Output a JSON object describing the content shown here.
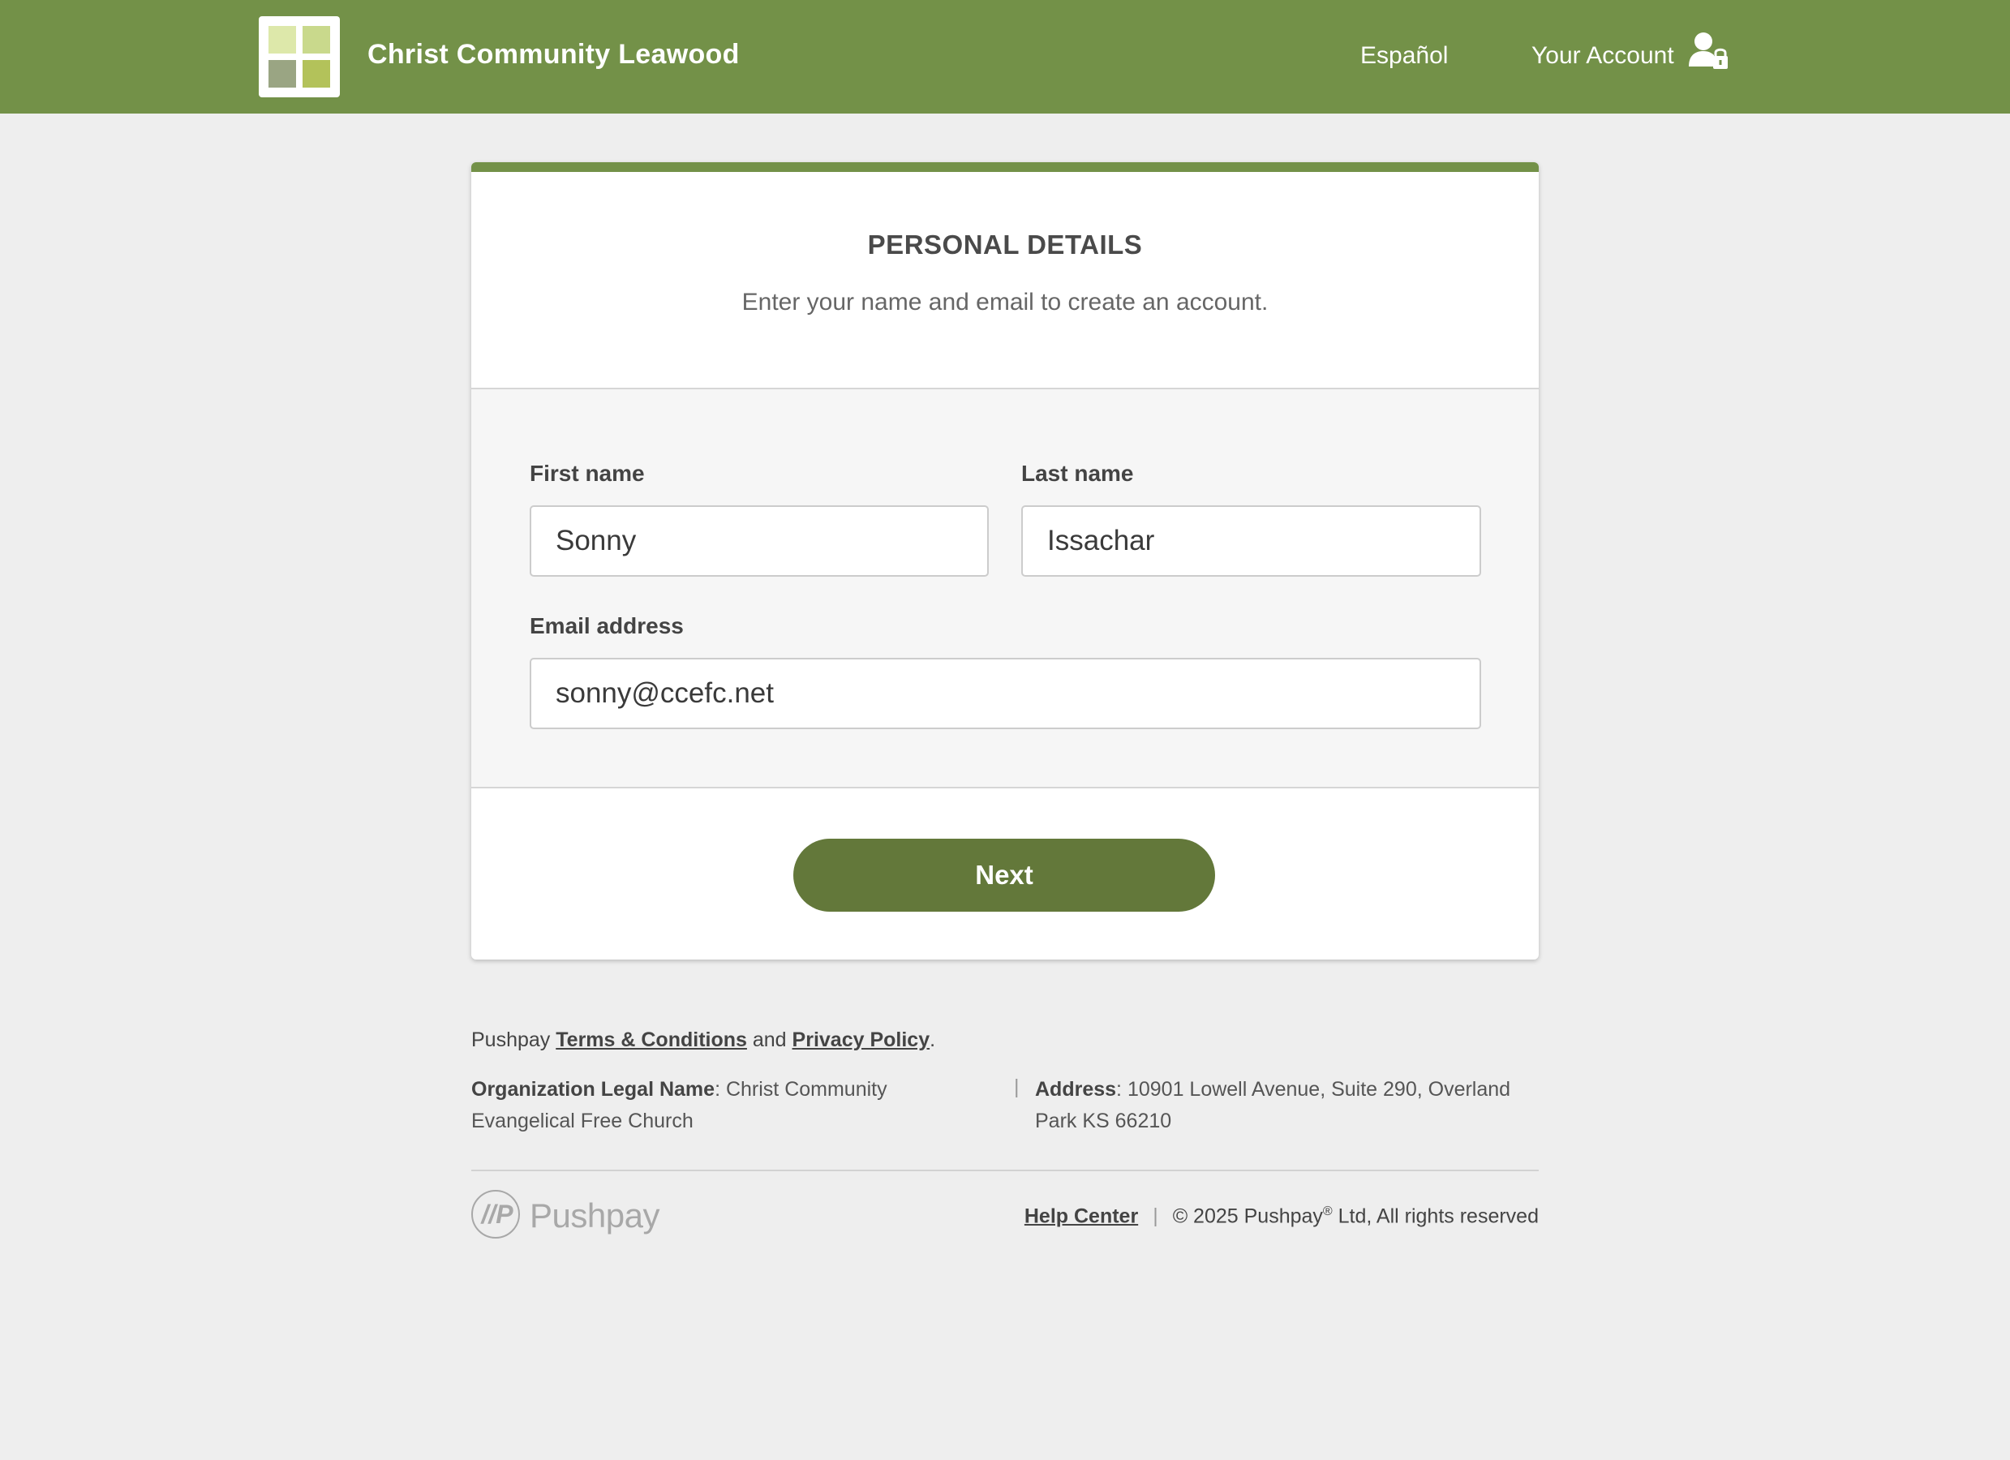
{
  "header": {
    "org_name": "Christ Community Leawood",
    "language_link": "Español",
    "account_link": "Your Account",
    "brand_color": "#739148"
  },
  "card": {
    "title": "PERSONAL DETAILS",
    "subtitle": "Enter your name and email to create an account.",
    "fields": {
      "first_name": {
        "label": "First name",
        "value": "Sonny"
      },
      "last_name": {
        "label": "Last name",
        "value": "Issachar"
      },
      "email": {
        "label": "Email address",
        "value": "sonny@ccefc.net"
      }
    },
    "next_label": "Next",
    "button_color": "#63783a"
  },
  "footer": {
    "legal_prefix": "Pushpay",
    "terms_link": "Terms & Conditions",
    "and_text": "and",
    "privacy_link": "Privacy Policy",
    "period": ".",
    "org_legal_label": "Organization Legal Name",
    "org_legal_value": "Christ Community Evangelical Free Church",
    "address_label": "Address",
    "address_value": "10901 Lowell Avenue, Suite 290, Overland Park KS 66210",
    "separator": "|",
    "pushpay_logo_text": "Pushpay",
    "pushpay_logo_mark": "//P",
    "help_center_link": "Help Center",
    "copyright_prefix": "© 2025 Pushpay",
    "copyright_sup": "®",
    "copyright_suffix": " Ltd, All rights reserved"
  }
}
